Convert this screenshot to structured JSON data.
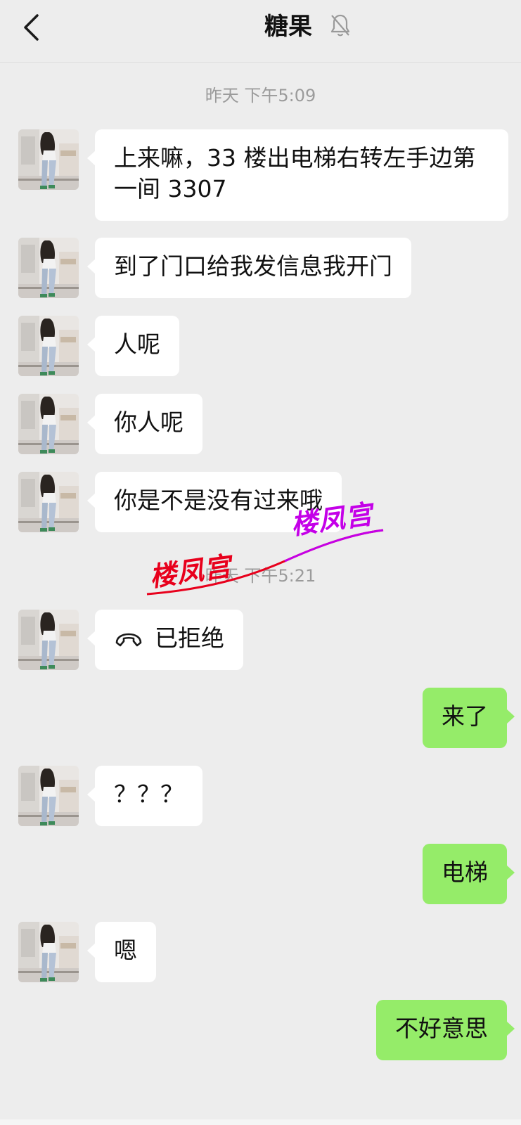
{
  "header": {
    "title": "糖果",
    "back_icon": "chevron-left-icon",
    "mute_icon": "bell-off-icon"
  },
  "timestamps": [
    "昨天 下午5:09",
    "昨天 下午5:21"
  ],
  "messages": [
    {
      "side": "in",
      "text": "上来嘛，33 楼出电梯右转左手边第一间 3307"
    },
    {
      "side": "in",
      "text": "到了门口给我发信息我开门"
    },
    {
      "side": "in",
      "text": "人呢"
    },
    {
      "side": "in",
      "text": "你人呢"
    },
    {
      "side": "in",
      "text": "你是不是没有过来哦"
    },
    {
      "side": "in",
      "text": "已拒绝",
      "icon": "phone-hangup-icon"
    },
    {
      "side": "out",
      "text": "来了"
    },
    {
      "side": "in",
      "text": "？？？"
    },
    {
      "side": "out",
      "text": "电梯"
    },
    {
      "side": "in",
      "text": "嗯"
    },
    {
      "side": "out",
      "text": "不好意思"
    }
  ],
  "watermarks": [
    "楼凤宫",
    "楼凤宫"
  ],
  "colors": {
    "background": "#ededed",
    "incoming_bubble": "#ffffff",
    "outgoing_bubble": "#95ec69",
    "timestamp": "#9b9b9b",
    "watermark_red": "#e8001c",
    "watermark_purple": "#c400e8"
  }
}
